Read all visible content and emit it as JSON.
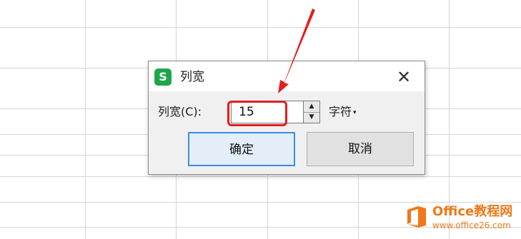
{
  "dialog": {
    "title": "列宽",
    "app_icon_letter": "S",
    "close_glyph": "✕",
    "field_label": "列宽(C):",
    "field_value": "15",
    "unit_label": "字符",
    "unit_caret": "▾",
    "ok_label": "确定",
    "cancel_label": "取消"
  },
  "stepper": {
    "up_glyph": "▲",
    "down_glyph": "▼"
  },
  "watermark": {
    "name": "Office教程网",
    "url": "www.office26.com"
  },
  "colors": {
    "annotation": "#e02020",
    "brand": "#f07818",
    "app_icon": "#1fa64b",
    "ok_border": "#3c8ddb"
  },
  "icons": [
    "app-icon",
    "close-icon",
    "stepper-up-icon",
    "stepper-down-icon",
    "dropdown-caret-icon",
    "annotation-arrow"
  ]
}
